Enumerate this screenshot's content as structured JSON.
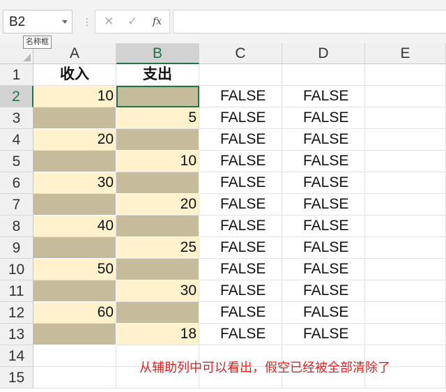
{
  "name_box": {
    "value": "B2",
    "tooltip": "名称框"
  },
  "formula_bar": {
    "value": "",
    "fx_label": "fx",
    "cancel_glyph": "✕",
    "enter_glyph": "✓"
  },
  "columns": [
    "A",
    "B",
    "C",
    "D",
    "E"
  ],
  "rows": [
    "1",
    "2",
    "3",
    "4",
    "5",
    "6",
    "7",
    "8",
    "9",
    "10",
    "11",
    "12",
    "13",
    "14",
    "15"
  ],
  "cells": {
    "A1": "收入",
    "B1": "支出",
    "A2": "10",
    "A4": "20",
    "A6": "30",
    "A8": "40",
    "A10": "50",
    "A12": "60",
    "B3": "5",
    "B5": "10",
    "B7": "20",
    "B9": "25",
    "B11": "30",
    "B13": "18",
    "C2": "FALSE",
    "C3": "FALSE",
    "C4": "FALSE",
    "C5": "FALSE",
    "C6": "FALSE",
    "C7": "FALSE",
    "C8": "FALSE",
    "C9": "FALSE",
    "C10": "FALSE",
    "C11": "FALSE",
    "C12": "FALSE",
    "C13": "FALSE",
    "D2": "FALSE",
    "D3": "FALSE",
    "D4": "FALSE",
    "D5": "FALSE",
    "D6": "FALSE",
    "D7": "FALSE",
    "D8": "FALSE",
    "D9": "FALSE",
    "D10": "FALSE",
    "D11": "FALSE",
    "D12": "FALSE",
    "D13": "FALSE"
  },
  "selected_cell": "B2",
  "annotation": "从辅助列中可以看出，假空已经被全部清除了",
  "colors": {
    "header_fill": "#fff2cc",
    "value_fill": "#fff2cc",
    "blank_fill": "#c6bb9b",
    "selection": "#217346",
    "annotation": "#e02020"
  }
}
